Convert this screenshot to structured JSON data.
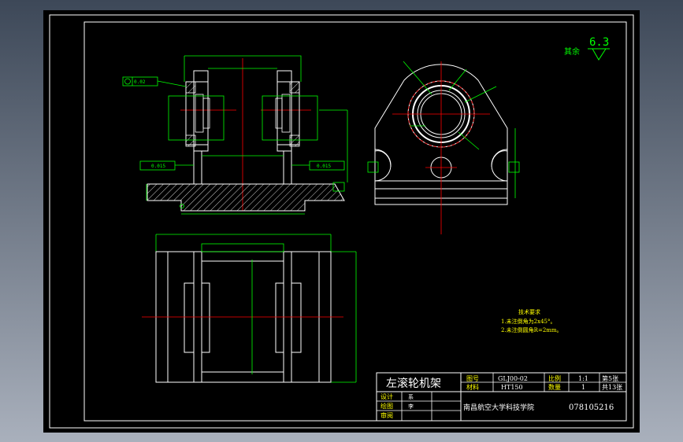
{
  "roughness": {
    "label": "其余",
    "value": "6.3"
  },
  "tech_requirements": {
    "heading": "技术要求",
    "item1": "1.未注倒角为2x45°。",
    "item2": "2.未注倒圆角R=2mm。"
  },
  "title_block": {
    "part_name": "左滚轮机架",
    "drawing_no_label": "图号",
    "drawing_no": "GLJ00-02",
    "scale_label": "比例",
    "scale": "1:1",
    "sheet": "第5张",
    "material_label": "材料",
    "material": "HT150",
    "qty_label": "数量",
    "qty": "1",
    "total_sheets": "共13张",
    "designer_label": "设计",
    "designer": "系",
    "drafter_label": "绘图",
    "drafter": "李",
    "reviewer_label": "审阅",
    "school": "南昌航空大学科技学院",
    "student_id": "078105216"
  },
  "tolerance_frames": [
    "0.02",
    "0.015",
    "0.015"
  ],
  "colors": {
    "outline": "#ffffff",
    "dimension": "#00ff00",
    "centerline": "#ff0000",
    "hatch": "#ffffff",
    "background": "#000000",
    "text_yellow": "#ffff00"
  }
}
